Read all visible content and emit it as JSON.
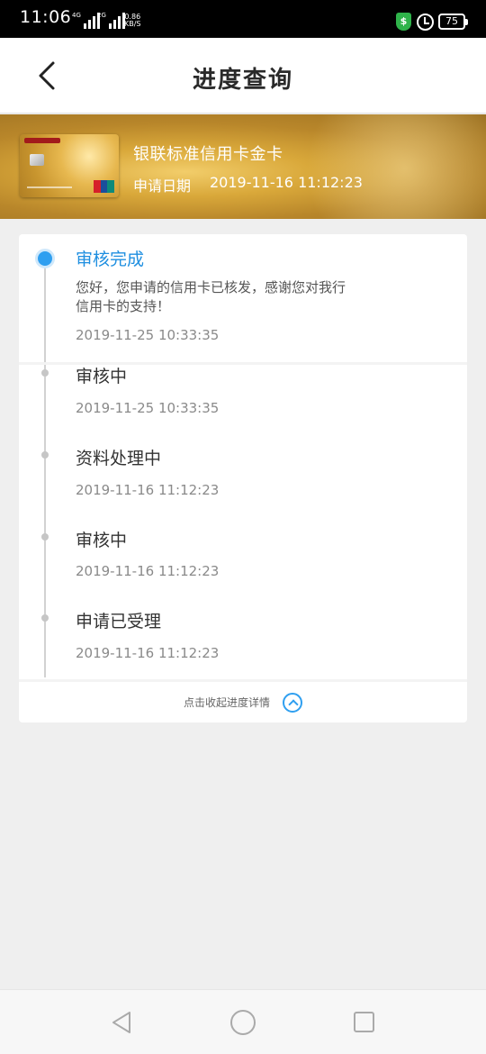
{
  "status_bar": {
    "time": "11:06",
    "network1": "4G",
    "network2": "2G",
    "speed_value": "0.86",
    "speed_unit": "KB/S",
    "battery": "75",
    "shield_icon": "shield-icon",
    "alarm_icon": "alarm-icon"
  },
  "header": {
    "title": "进度查询",
    "back_icon": "chevron-left-icon"
  },
  "banner": {
    "card_name": "银联标准信用卡金卡",
    "apply_label": "申请日期",
    "apply_date": "2019-11-16 11:12:23"
  },
  "timeline": {
    "items": [
      {
        "status": "审核完成",
        "desc": "您好，您申请的信用卡已核发，感谢您对我行信用卡的支持！",
        "time": "2019-11-25 10:33:35"
      },
      {
        "status": "审核中",
        "time": "2019-11-25 10:33:35"
      },
      {
        "status": "资料处理中",
        "time": "2019-11-16 11:12:23"
      },
      {
        "status": "审核中",
        "time": "2019-11-16 11:12:23"
      },
      {
        "status": "申请已受理",
        "time": "2019-11-16 11:12:23"
      }
    ],
    "collapse_label": "点击收起进度详情",
    "collapse_icon": "chevron-up-circle-icon"
  },
  "colors": {
    "accent": "#2f9ff0",
    "gold": "#d9a83a"
  }
}
